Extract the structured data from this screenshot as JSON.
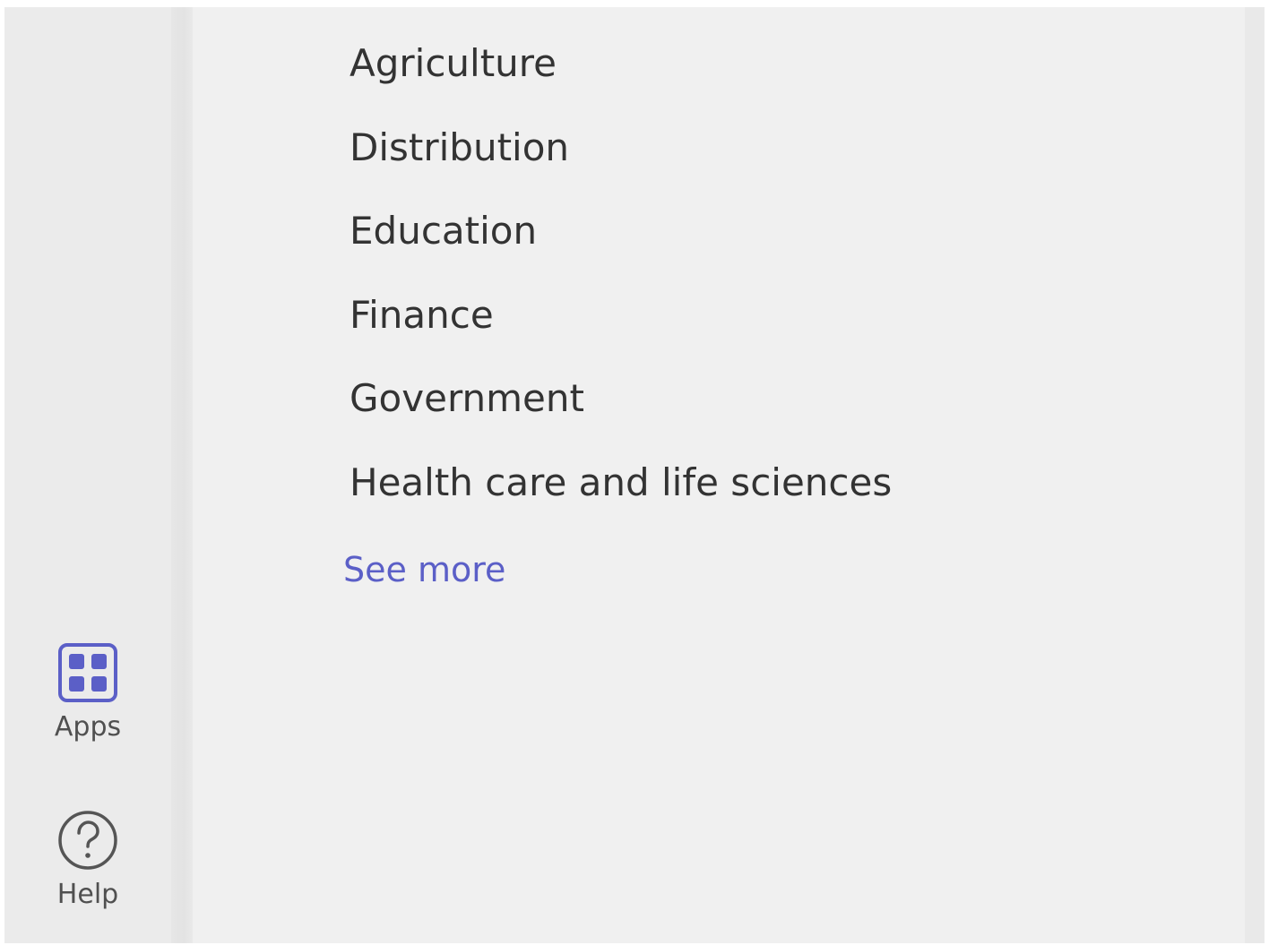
{
  "accent_color": "#5b5fc7",
  "rail": {
    "items": [
      {
        "label": "Apps",
        "icon": "apps-grid-icon"
      },
      {
        "label": "Help",
        "icon": "help-circle-icon"
      }
    ]
  },
  "industries": {
    "items": [
      "Agriculture",
      "Distribution",
      "Education",
      "Finance",
      "Government",
      "Health care and life sciences"
    ],
    "see_more_label": "See more"
  }
}
